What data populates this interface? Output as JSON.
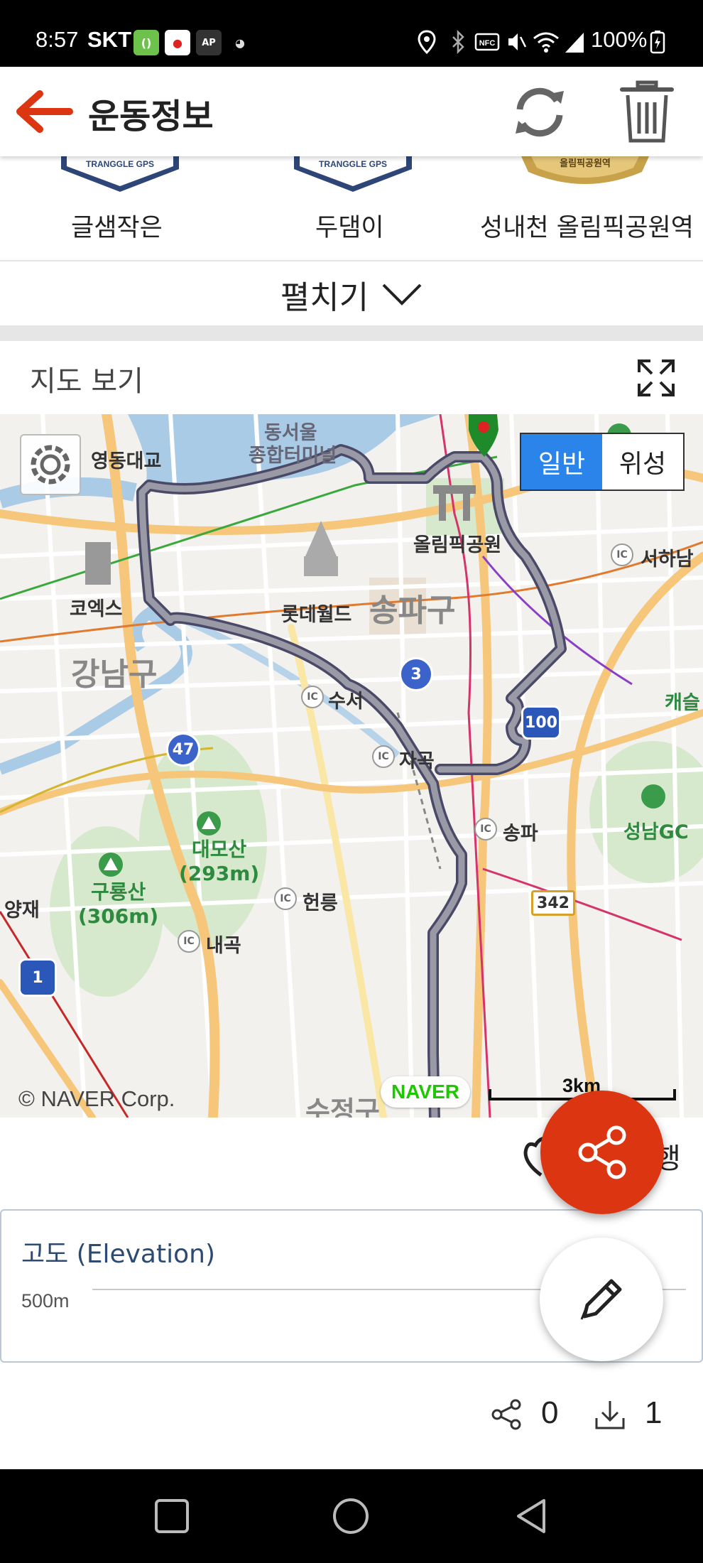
{
  "status_bar": {
    "time": "8:57",
    "carrier": "SKT",
    "battery": "100%",
    "left_icons": [
      "bracket-app-icon",
      "red-app-icon",
      "ap-app-icon",
      "cat-app-icon"
    ],
    "right_icons": [
      "location-icon",
      "bluetooth-icon",
      "nfc-icon",
      "mute-icon",
      "wifi-icon",
      "signal-icon",
      "battery-charging-icon"
    ]
  },
  "app_bar": {
    "title": "운동정보",
    "accent_color": "#dc3512"
  },
  "badges": [
    {
      "label": "글샘작은",
      "emblem": "TRANGGLE GPS"
    },
    {
      "label": "두댐이",
      "emblem": "TRANGGLE GPS"
    },
    {
      "label": "성내천 올림픽공원역",
      "emblem": "올림픽공원역"
    }
  ],
  "expand": {
    "label": "펼치기"
  },
  "map_section": {
    "title": "지도 보기",
    "map_type": {
      "normal": "일반",
      "satellite": "위성",
      "selected": "일반"
    },
    "labels": {
      "dongseoul": "동서울",
      "terminal": "종합터미널",
      "yeongdong": "영동대교",
      "olympic_park": "올림픽공원",
      "hanam": "서하남",
      "coex": "코엑스",
      "lotte_world": "롯데월드",
      "songpa_gu": "송파구",
      "gangnam_gu": "강남구",
      "caesar": "캐슬",
      "ic_suseo": "수서",
      "ic_jagok": "자곡",
      "ic_songpa": "송파",
      "seongnam_gc": "성남GC",
      "daemosan": "대모산",
      "daemosan_height": "(293m)",
      "gurongsan": "구룡산",
      "gurongsan_height": "(306m)",
      "yangjae": "양재",
      "ic_heolleung": "헌릉",
      "ic_naegok": "내곡",
      "sujeong_gu": "수정구",
      "ic": "IC"
    },
    "route_numbers": {
      "r3": "3",
      "r47": "47",
      "r100": "100",
      "r342": "342",
      "r1": "1"
    },
    "copyright": "© NAVER Corp.",
    "naver_logo": "NAVER",
    "scale": "3km"
  },
  "partial_action_label": "행",
  "elevation": {
    "title": "고도 (Elevation)",
    "axis_label": "500m"
  },
  "stats": {
    "shares": "0",
    "downloads": "1"
  },
  "nav_bar": {
    "buttons": [
      "recent-apps",
      "home",
      "back"
    ]
  }
}
